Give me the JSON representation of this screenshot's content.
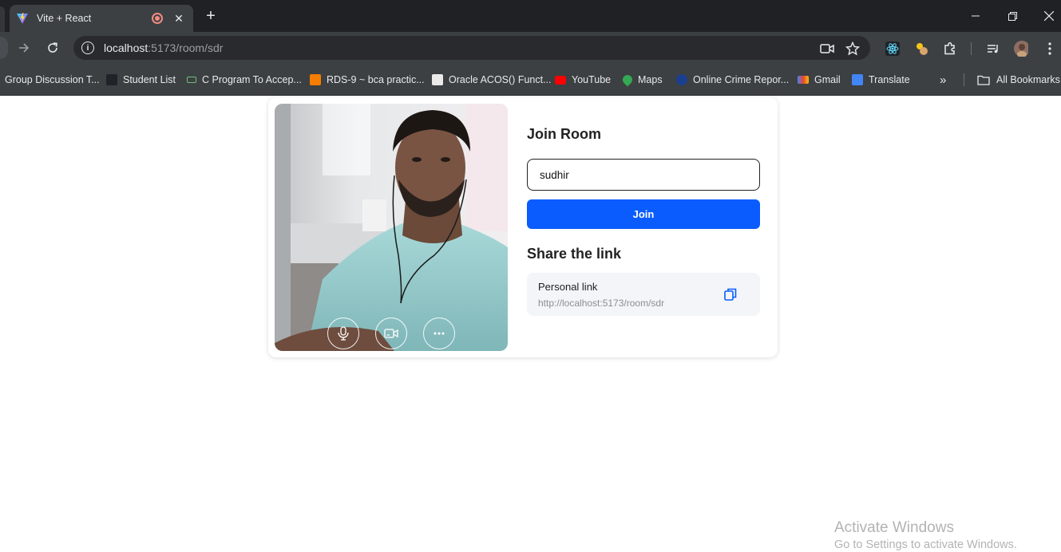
{
  "browser": {
    "tab_title": "Vite + React",
    "url_host": "localhost",
    "url_path": ":5173/room/sdr",
    "bookmarks": [
      "Group Discussion T...",
      "Student List",
      "C Program To Accep...",
      "RDS-9 ~ bca practic...",
      "Oracle ACOS() Funct...",
      "YouTube",
      "Maps",
      "Online Crime Repor...",
      "Gmail",
      "Translate"
    ],
    "all_bookmarks": "All Bookmarks"
  },
  "join": {
    "heading": "Join Room",
    "name_value": "sudhir",
    "join_label": "Join"
  },
  "share": {
    "heading": "Share the link",
    "link_label": "Personal link",
    "link_url": "http://localhost:5173/room/sdr"
  },
  "video": {
    "controls": [
      "mic-icon",
      "camera-icon",
      "more-icon"
    ]
  },
  "watermark": {
    "line1": "Activate Windows",
    "line2": "Go to Settings to activate Windows."
  },
  "colors": {
    "accent": "#0a5cff",
    "chrome_dark": "#202124",
    "chrome_toolbar": "#3c4043"
  }
}
